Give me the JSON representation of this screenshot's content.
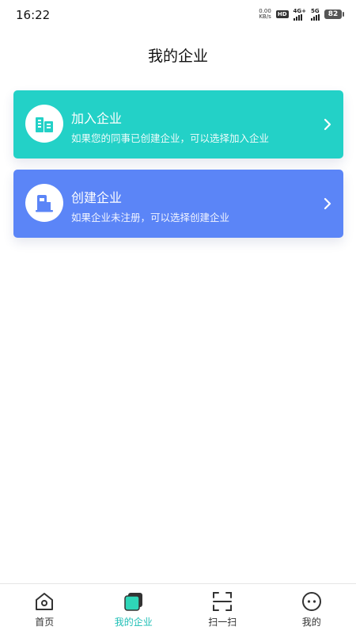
{
  "status_bar": {
    "time": "16:22",
    "net_speed_value": "0.00",
    "net_speed_unit": "KB/s",
    "hd_label": "HD",
    "sim_1": "1",
    "sim_2": "2",
    "network_1": "4G+",
    "network_2": "5G",
    "battery": "82"
  },
  "header": {
    "title": "我的企业"
  },
  "cards": [
    {
      "title": "加入企业",
      "description": "如果您的同事已创建企业，可以选择加入企业",
      "color": "#23d1c7",
      "icon": "buildings-icon"
    },
    {
      "title": "创建企业",
      "description": "如果企业未注册，可以选择创建企业",
      "color": "#5b85f7",
      "icon": "building-create-icon"
    }
  ],
  "bottom_nav": {
    "items": [
      {
        "label": "首页",
        "icon": "home-icon",
        "active": false
      },
      {
        "label": "我的企业",
        "icon": "enterprise-icon",
        "active": true
      },
      {
        "label": "扫一扫",
        "icon": "scan-icon",
        "active": false
      },
      {
        "label": "我的",
        "icon": "profile-icon",
        "active": false
      }
    ],
    "active_color": "#1fbfb6"
  }
}
